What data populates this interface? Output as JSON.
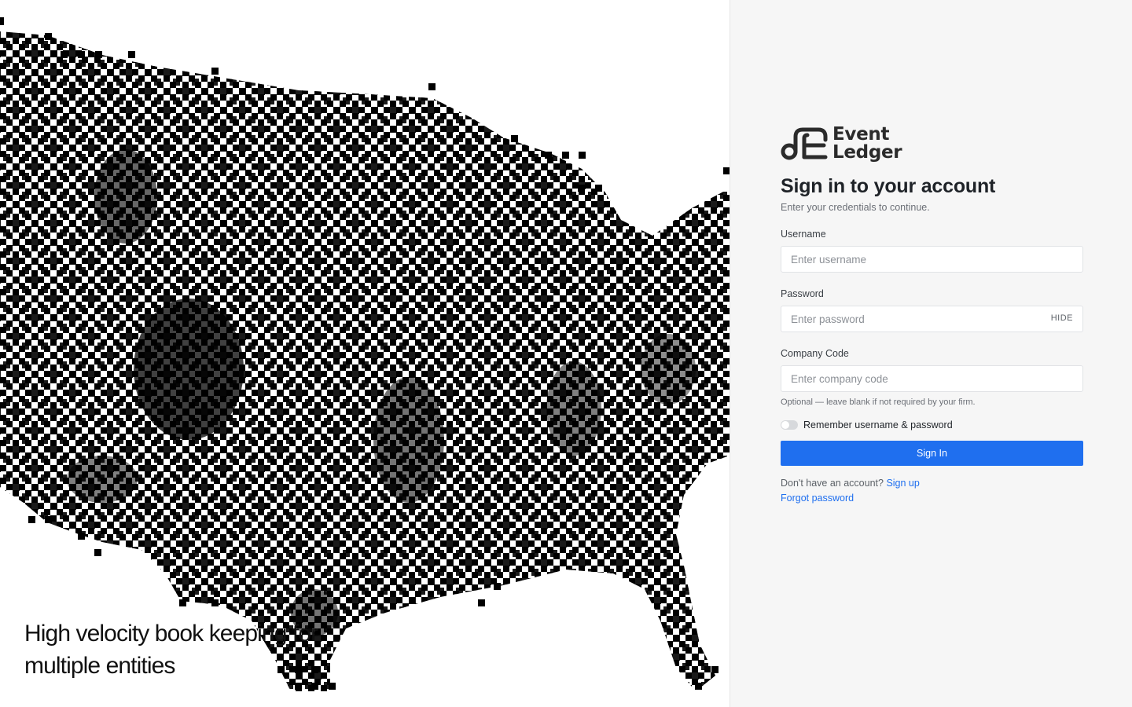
{
  "hero": {
    "tagline_line1": "High velocity book keeping for",
    "tagline_line2": "multiple entities"
  },
  "brand": {
    "name_line1": "Event",
    "name_line2": "Ledger"
  },
  "login": {
    "title": "Sign in to your account",
    "subtitle": "Enter your credentials to continue.",
    "username_label": "Username",
    "username_placeholder": "Enter username",
    "password_label": "Password",
    "password_placeholder": "Enter password",
    "password_toggle_label": "HIDE",
    "company_label": "Company Code",
    "company_placeholder": "Enter company code",
    "company_hint": "Optional — leave blank if not required by your firm.",
    "remember_label": "Remember username & password",
    "remember_checked": false,
    "signin_label": "Sign In",
    "no_account_text": "Don't have an account?",
    "signup_link": "Sign up",
    "forgot_link": "Forgot password"
  },
  "colors": {
    "accent": "#1f6fef",
    "panel_bg": "#f6f6f6",
    "map_dots": "#000000"
  }
}
